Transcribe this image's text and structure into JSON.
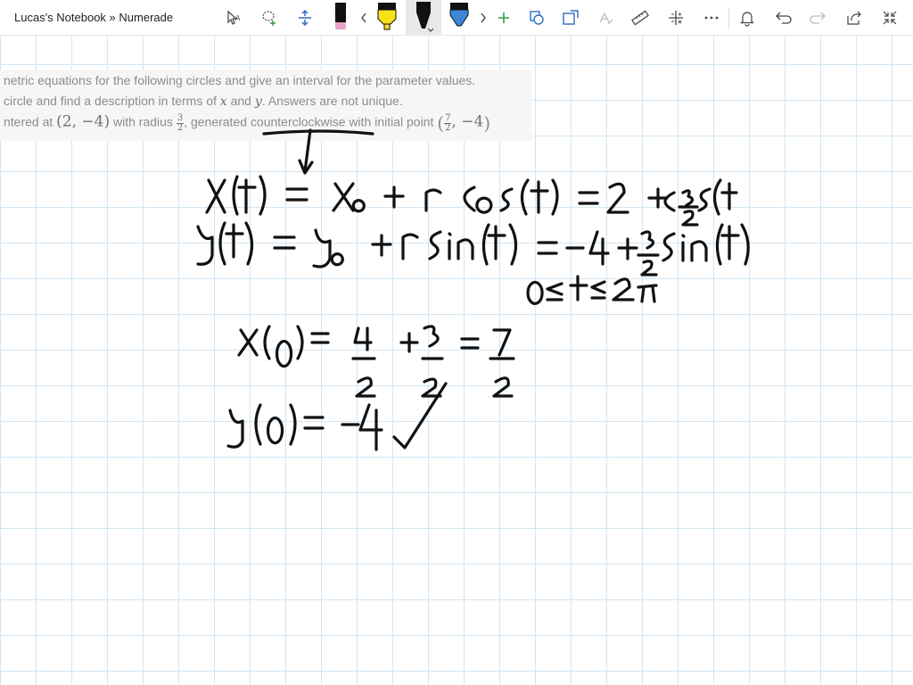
{
  "app": {
    "title": "Lucas's Notebook » Numerade"
  },
  "toolbar": {
    "tools": [
      {
        "name": "select-text-tool",
        "icon": "cursor-text-icon"
      },
      {
        "name": "lasso-tool",
        "icon": "lasso-plus-icon"
      },
      {
        "name": "insert-space-tool",
        "icon": "insert-space-icon"
      },
      {
        "name": "pen-pink",
        "icon": "pen-icon",
        "color": "#e8a3c8"
      },
      {
        "name": "highlighter-yellow",
        "icon": "highlighter-icon",
        "color": "#f7e11a"
      },
      {
        "name": "pen-black",
        "icon": "pen-icon",
        "color": "#111111"
      },
      {
        "name": "pen-blue",
        "icon": "pen-icon",
        "color": "#3d86d8"
      },
      {
        "name": "add-pen",
        "icon": "plus-icon",
        "color": "#2e9e47"
      }
    ],
    "colors": {
      "accent_green": "#2e9e47",
      "tool_blue": "#2b6fc2"
    }
  },
  "problem": {
    "line1": "netric equations for the following circles and give an interval for the parameter values.",
    "line2_a": "circle and find a description in terms of ",
    "x": "x",
    "and": " and ",
    "y": "y",
    "line2_b": ". Answers are not unique.",
    "line3_a": "ntered at ",
    "center": "(2, −4)",
    "with_radius": " with radius ",
    "r_num": "3",
    "r_den": "2",
    "generated": ", generated ",
    "ccw": "counterclockwise",
    "initial": " with initial point ",
    "pt_num": "7",
    "pt_den": "2",
    "pt_y": ", −4"
  },
  "handwriting": {
    "eq_x": "x(t) = x0 + r cos(t) = 2 + 3/2 cos(t)",
    "eq_y": "y(t) = y0 + r sin(t) = −4 + 3/2 sin(t)",
    "interval": "0 ≤ t ≤ 2π",
    "check_x": "x(0) = 4/2 + 3/2 = 7/2",
    "check_y": "y(0) = −4 ✓",
    "ink_color": "#111111"
  }
}
